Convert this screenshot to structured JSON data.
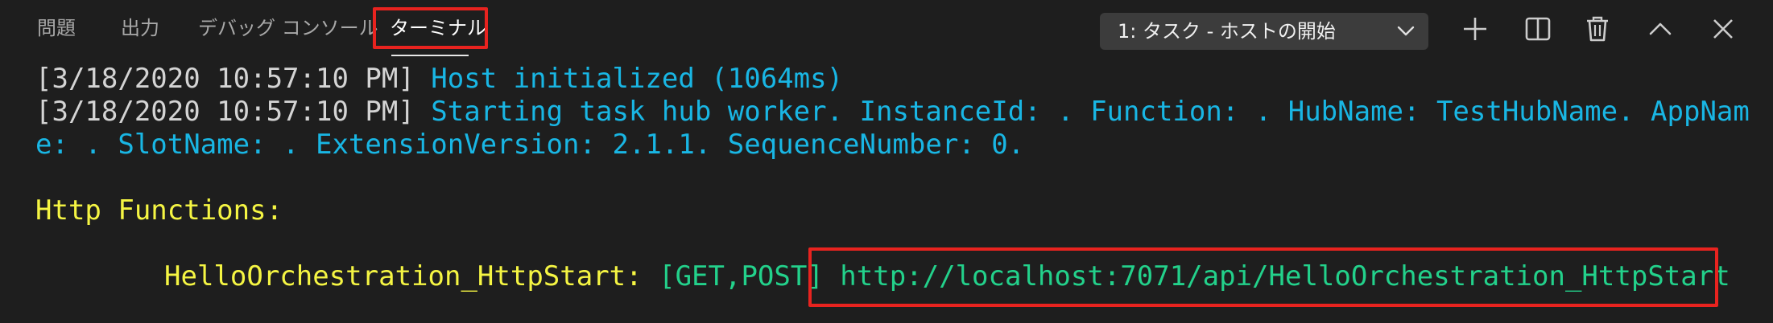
{
  "tabs": [
    {
      "label": "問題"
    },
    {
      "label": "出力"
    },
    {
      "label": "デバッグ コンソール"
    },
    {
      "label": "ターミナル",
      "active": true
    }
  ],
  "terminal_selector": {
    "selected": "1: タスク - ホストの開始"
  },
  "toolbar_icons": [
    "plus-icon",
    "split-icon",
    "trash-icon",
    "chevron-up-icon",
    "close-icon"
  ],
  "terminal": {
    "line1_ts": "[3/18/2020 10:57:10 PM]",
    "line1_msg": "Host initialized (1064ms)",
    "line2_ts": "[3/18/2020 10:57:10 PM]",
    "line2_msg": "Starting task hub worker. InstanceId: . Function: . HubName: TestHubName. AppNam",
    "line3_msg": "e: . SlotName: . ExtensionVersion: 2.1.1. SequenceNumber: 0.",
    "http_header": "Http Functions:",
    "function_name": "HelloOrchestration_HttpStart:",
    "methods": "[GET,POST]",
    "url": "http://localhost:7071/api/HelloOrchestration_HttpStart"
  },
  "colors": {
    "background": "#1e1e1e",
    "timestamp": "#d4d4d4",
    "cyan": "#19b6e4",
    "yellow": "#f5f543",
    "green": "#23d18b",
    "highlight": "#e8231f"
  }
}
